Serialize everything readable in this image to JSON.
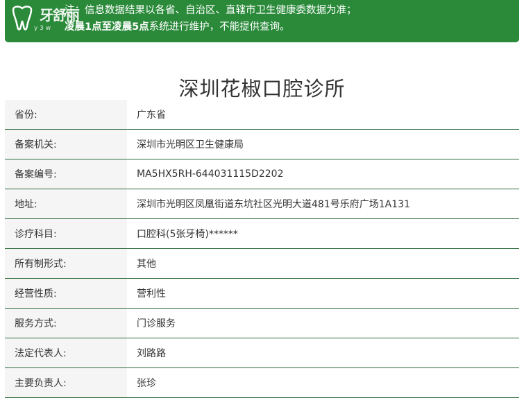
{
  "notice": {
    "watermark_brand": "牙舒丽",
    "watermark_sub": "y 3 w",
    "line1": "注：信息数据结果以各省、自治区、直辖市卫生健康委数据为准；",
    "line2_highlight": "凌晨1点至凌晨5点",
    "line2_rest": "系统进行维护，不能提供查询。",
    "bg_color": "#2a8a3a"
  },
  "page": {
    "title": "深圳花椒口腔诊所"
  },
  "rows": [
    {
      "label": "省份:",
      "value": "广东省"
    },
    {
      "label": "备案机关:",
      "value": "深圳市光明区卫生健康局"
    },
    {
      "label": "备案编号:",
      "value": "MA5HX5RH-644031115D2202"
    },
    {
      "label": "地址:",
      "value": "深圳市光明区凤凰街道东坑社区光明大道481号乐府广场1A131"
    },
    {
      "label": "诊疗科目:",
      "value": "口腔科(5张牙椅)******"
    },
    {
      "label": "所有制形式:",
      "value": "其他"
    },
    {
      "label": "经营性质:",
      "value": "营利性"
    },
    {
      "label": "服务方式:",
      "value": "门诊服务"
    },
    {
      "label": "法定代表人:",
      "value": "刘路路"
    },
    {
      "label": "主要负责人:",
      "value": "张珍"
    }
  ],
  "colors": {
    "border": "#2b6a3a",
    "label_bg": "#f5f5f5"
  }
}
